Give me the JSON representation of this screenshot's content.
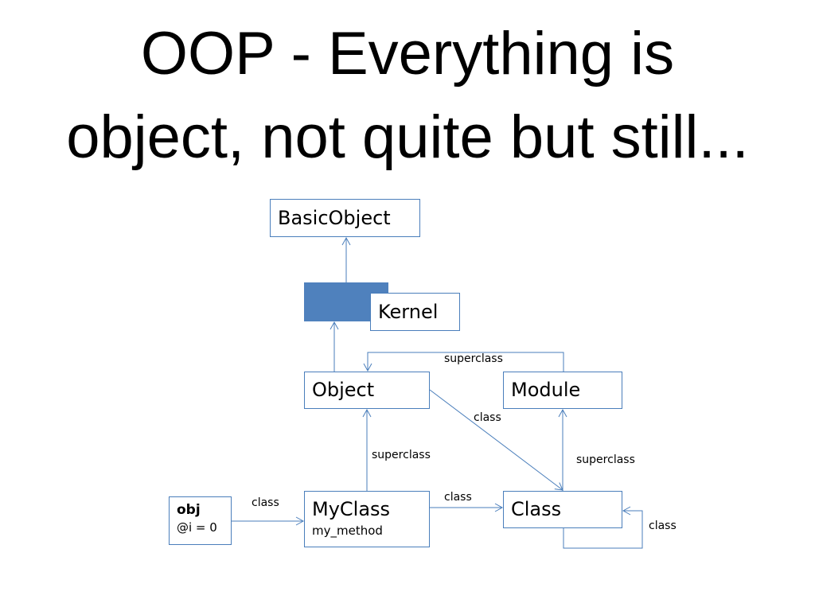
{
  "title": {
    "line1": "OOP - Everything is",
    "line2": "object, not quite but still..."
  },
  "nodes": {
    "basic_object": "BasicObject",
    "kernel": "Kernel",
    "object": "Object",
    "module": "Module",
    "obj": {
      "name": "obj",
      "ivar": "@i = 0"
    },
    "myclass": {
      "name": "MyClass",
      "method": "my_method"
    },
    "class": "Class"
  },
  "edges": {
    "module_to_object": "superclass",
    "object_to_class": "class",
    "myclass_to_object": "superclass",
    "class_to_module": "superclass",
    "obj_to_myclass": "class",
    "myclass_to_class": "class",
    "class_to_class": "class"
  },
  "colors": {
    "line": "#4a7ebb",
    "module_block": "#4f81bd"
  }
}
